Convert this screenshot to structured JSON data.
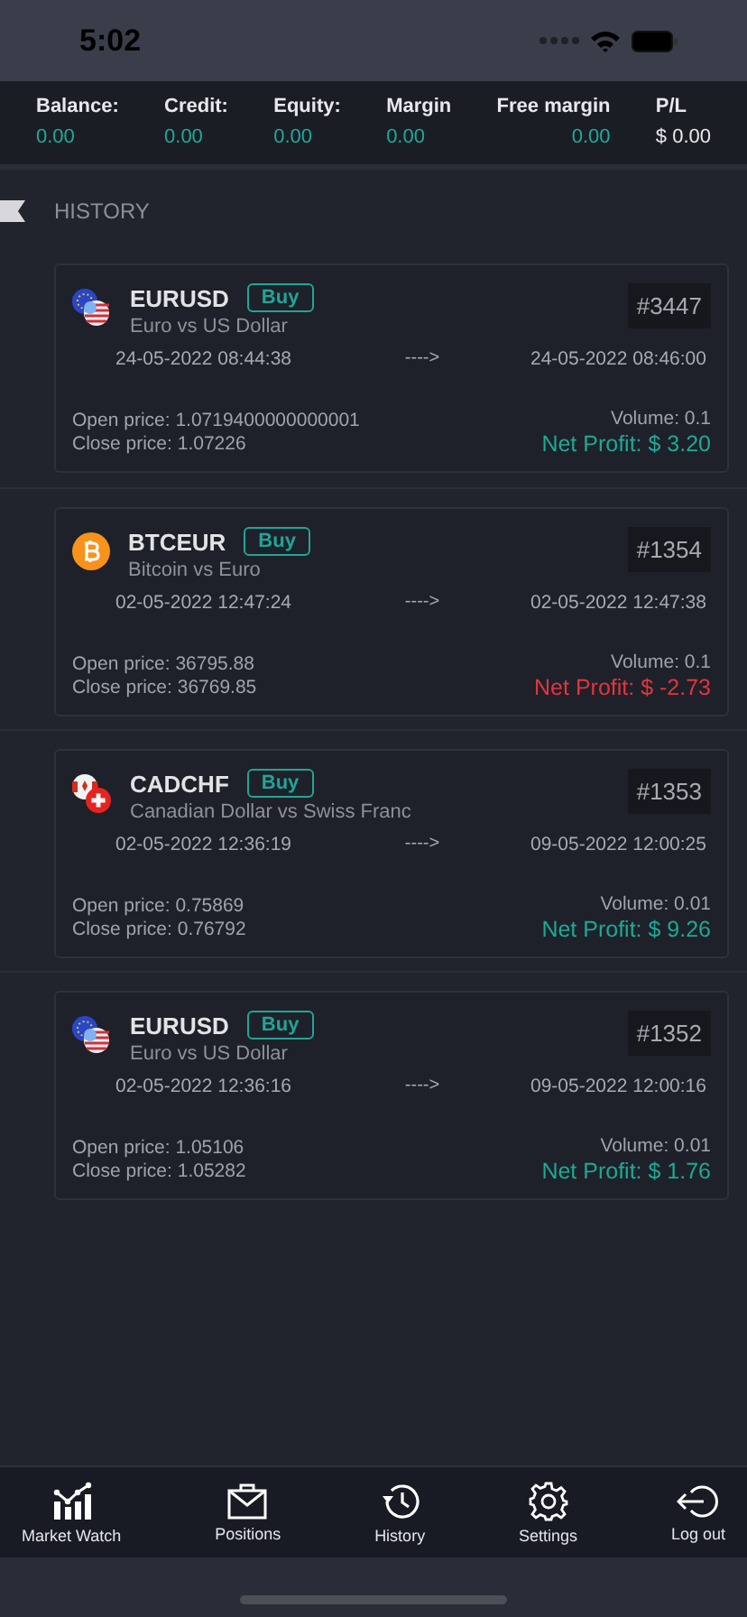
{
  "status_bar": {
    "time": "5:02"
  },
  "account_summary": [
    {
      "label": "Balance:",
      "value": "0.00",
      "kind": "teal"
    },
    {
      "label": "Credit:",
      "value": "0.00",
      "kind": "teal"
    },
    {
      "label": "Equity:",
      "value": "0.00",
      "kind": "teal"
    },
    {
      "label": "Margin",
      "value": "0.00",
      "kind": "teal"
    },
    {
      "label": "Free margin",
      "value": "0.00",
      "kind": "teal"
    },
    {
      "label": "P/L",
      "value": "$ 0.00",
      "kind": "plain"
    }
  ],
  "section_title": "HISTORY",
  "trades": [
    {
      "symbol": "EURUSD",
      "side": "Buy",
      "description": "Euro vs US Dollar",
      "ticket": "#3447",
      "open_time": "24-05-2022 08:44:38",
      "arrow": "---->",
      "close_time": "24-05-2022 08:46:00",
      "open_price": "Open price: 1.0719400000000001",
      "close_price": "Close price: 1.07226",
      "volume": "Volume: 0.1",
      "net_profit": "Net Profit: $ 3.20",
      "kind": "gain"
    },
    {
      "symbol": "BTCEUR",
      "side": "Buy",
      "description": "Bitcoin vs Euro",
      "ticket": "#1354",
      "open_time": "02-05-2022 12:47:24",
      "arrow": "---->",
      "close_time": "02-05-2022 12:47:38",
      "open_price": "Open price: 36795.88",
      "close_price": "Close price: 36769.85",
      "volume": "Volume: 0.1",
      "net_profit": "Net Profit: $ -2.73",
      "kind": "loss"
    },
    {
      "symbol": "CADCHF",
      "side": "Buy",
      "description": "Canadian Dollar vs Swiss Franc",
      "ticket": "#1353",
      "open_time": "02-05-2022 12:36:19",
      "arrow": "---->",
      "close_time": "09-05-2022 12:00:25",
      "open_price": "Open price: 0.75869",
      "close_price": "Close price: 0.76792",
      "volume": "Volume: 0.01",
      "net_profit": "Net Profit: $ 9.26",
      "kind": "gain"
    },
    {
      "symbol": "EURUSD",
      "side": "Buy",
      "description": "Euro vs US Dollar",
      "ticket": "#1352",
      "open_time": "02-05-2022 12:36:16",
      "arrow": "---->",
      "close_time": "09-05-2022 12:00:16",
      "open_price": "Open price: 1.05106",
      "close_price": "Close price: 1.05282",
      "volume": "Volume: 0.01",
      "net_profit": "Net Profit: $ 1.76",
      "kind": "gain"
    }
  ],
  "tab_bar": [
    {
      "label": "Market Watch"
    },
    {
      "label": "Positions"
    },
    {
      "label": "History"
    },
    {
      "label": "Settings"
    },
    {
      "label": "Log out"
    }
  ]
}
